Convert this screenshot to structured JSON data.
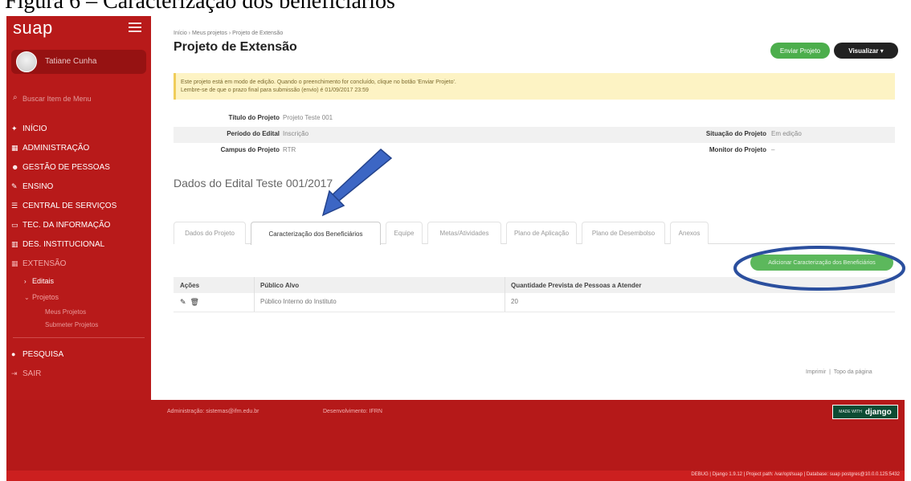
{
  "caption": "Figura 6 – Caracterização dos beneficiários",
  "sidebar": {
    "brand": "suap",
    "user_name": "Tatiane Cunha",
    "search_placeholder": "Buscar Item de Menu",
    "items": [
      {
        "icon": "home-icon",
        "glyph": "✦",
        "label": "INÍCIO"
      },
      {
        "icon": "admin-icon",
        "glyph": "▦",
        "label": "ADMINISTRAÇÃO"
      },
      {
        "icon": "people-icon",
        "glyph": "☻",
        "label": "GESTÃO DE PESSOAS"
      },
      {
        "icon": "pencil-icon",
        "glyph": "✎",
        "label": "ENSINO"
      },
      {
        "icon": "list-icon",
        "glyph": "☰",
        "label": "CENTRAL DE SERVIÇOS"
      },
      {
        "icon": "monitor-icon",
        "glyph": "▭",
        "label": "TEC. DA INFORMAÇÃO"
      },
      {
        "icon": "chart-icon",
        "glyph": "▥",
        "label": "DES. INSTITUCIONAL"
      },
      {
        "icon": "extension-icon",
        "glyph": "▦",
        "label": "EXTENSÃO"
      }
    ],
    "sub_editais": "Editais",
    "sub_projetos": "Projetos",
    "subsub_meus": "Meus Projetos",
    "subsub_submeter": "Submeter Projetos",
    "pesquisa": "PESQUISA",
    "sair": "SAIR"
  },
  "header": {
    "breadcrumb": [
      "Início",
      "Meus projetos",
      "Projeto de Extensão"
    ],
    "title": "Projeto de Extensão",
    "send_label": "Enviar Projeto",
    "view_label": "Visualizar ▾"
  },
  "alert": {
    "line1": "Este projeto está em modo de edição. Quando o preenchimento for concluído, clique no botão 'Enviar Projeto'.",
    "line2": "Lembre-se de que o prazo final para submissão (envio) é 01/09/2017 23:59"
  },
  "info": {
    "titulo_label": "Título do Projeto",
    "titulo_value": "Projeto Teste 001",
    "periodo_label": "Período do Edital",
    "periodo_value": "Inscrição",
    "situacao_label": "Situação do Projeto",
    "situacao_value": "Em edição",
    "campus_label": "Campus do Projeto",
    "campus_value": "RTR",
    "monitor_label": "Monitor do Projeto",
    "monitor_value": "–"
  },
  "section_title": "Dados do Edital Teste 001/2017",
  "tabs": [
    "Dados do Projeto",
    "Caracterização dos Beneficiários",
    "Equipe",
    "Metas/Atividades",
    "Plano de Aplicação",
    "Plano de Desembolso",
    "Anexos"
  ],
  "add_button": "Adicionar Caracterização dos Beneficiários",
  "table": {
    "headers": [
      "Ações",
      "Público Alvo",
      "Quantidade Prevista de Pessoas a Atender"
    ],
    "rows": [
      {
        "publico": "Público Interno do Instituto",
        "quantidade": "20"
      }
    ]
  },
  "page_links": {
    "print": "Imprimir",
    "top": "Topo da página"
  },
  "footer": {
    "admin": "Administração: sistemas@ifrn.edu.br",
    "dev": "Desenvolvimento: IFRN",
    "django_small": "MADE WITH",
    "django": "django",
    "debug": "DEBUG | Django 1.9.12 | Project path: /var/opt/suap | Database: suap postgres@10.0.0.125:5432"
  },
  "colors": {
    "sidebar": "#b81a1a",
    "footer": "#b51919",
    "primary_button": "#4cae4c",
    "annotation_blue": "#2b4f9e"
  }
}
